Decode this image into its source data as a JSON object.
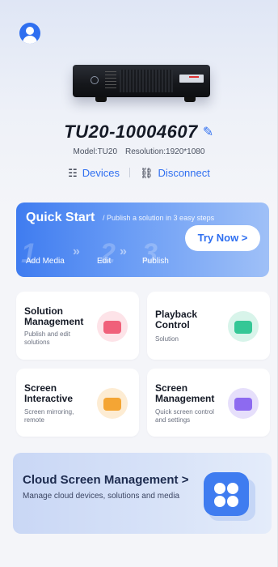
{
  "device": {
    "name": "TU20-10004607",
    "model_label": "Model:",
    "model_value": "TU20",
    "resolution_label": "Resolution:",
    "resolution_value": "1920*1080",
    "devices_label": "Devices",
    "disconnect_label": "Disconnect"
  },
  "quick_start": {
    "title": "Quick Start",
    "subtitle": "/ Publish a solution in 3 easy steps",
    "steps": [
      {
        "num": "1",
        "label": "Add Media"
      },
      {
        "num": "2",
        "label": "Edit"
      },
      {
        "num": "3",
        "label": "Publish"
      }
    ],
    "button": "Try Now >"
  },
  "cards": [
    {
      "title": "Solution Management",
      "subtitle": "Publish and edit solutions",
      "icon": "folder-icon",
      "color": "#f0607a"
    },
    {
      "title": "Playback Control",
      "subtitle": "Solution",
      "icon": "play-icon",
      "color": "#35c796"
    },
    {
      "title": "Screen Interactive",
      "subtitle": "Screen mirroring, remote",
      "icon": "screen-plus-icon",
      "color": "#f4a534"
    },
    {
      "title": "Screen Management",
      "subtitle": "Quick screen control and settings",
      "icon": "hexagon-settings-icon",
      "color": "#8d6af0"
    }
  ],
  "cloud": {
    "title": "Cloud Screen Management >",
    "subtitle": "Manage cloud devices, solutions and media"
  },
  "colors": {
    "accent": "#2f6ff0"
  }
}
